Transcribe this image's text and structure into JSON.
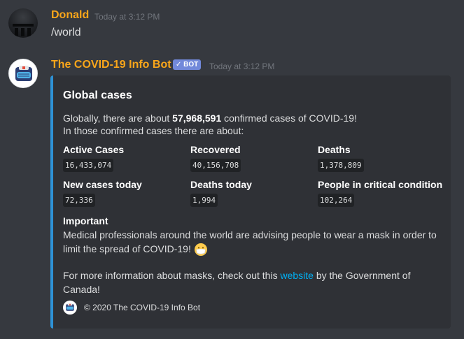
{
  "messages": [
    {
      "author": "Donald",
      "timestamp": "Today at 3:12 PM",
      "text": "/world",
      "author_color": "#faa61a"
    },
    {
      "author": "The COVID-19 Info Bot",
      "bot_badge": "BOT",
      "timestamp": "Today at 3:12 PM",
      "author_color": "#faa61a",
      "embed": {
        "accent_color": "#2e92d6",
        "title": "Global cases",
        "description_prefix": "Globally, there are about ",
        "total_cases": "57,968,591",
        "description_suffix": " confirmed cases of COVID-19!",
        "description_line2": "In those confirmed cases there are about:",
        "fields": [
          {
            "name": "Active Cases",
            "value": "16,433,074"
          },
          {
            "name": "Recovered",
            "value": "40,156,708"
          },
          {
            "name": "Deaths",
            "value": "1,378,809"
          },
          {
            "name": "New cases today",
            "value": "72,336"
          },
          {
            "name": "Deaths today",
            "value": "1,994"
          },
          {
            "name": "People in critical condition",
            "value": "102,264"
          }
        ],
        "important_title": "Important",
        "important_text": "Medical professionals around the world are advising people to wear a mask in order to limit the spread of COVID-19!",
        "more_prefix": "For more information about masks, check out this ",
        "more_link": "website",
        "more_suffix": " by the Government of Canada!",
        "footer": "© 2020 The COVID-19 Info Bot"
      }
    }
  ]
}
